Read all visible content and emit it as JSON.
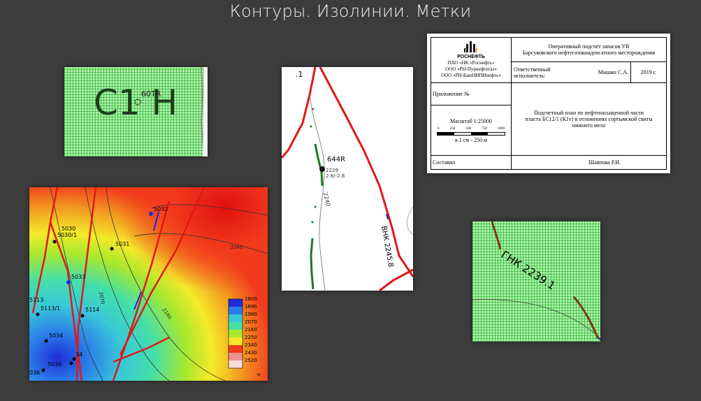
{
  "title": "Контуры. Изолинии. Метки",
  "panel1": {
    "label": "C1 H",
    "marker": "60TR"
  },
  "panel2": {
    "top_label": ".1",
    "well": "644R",
    "well_sub1": "2239",
    "well_sub2": "2.8/-2.8",
    "isoline": "2240",
    "contour": "ВНК 2245.8"
  },
  "panel3": {
    "wells": [
      "5032",
      "5030",
      "5030/1",
      "5031",
      "5033",
      "5113",
      "5113/1",
      "5114",
      "5034",
      "5036",
      "34",
      "036"
    ],
    "isolines": [
      "2340",
      "2070",
      "2160"
    ],
    "legend": [
      "1800",
      "1890",
      "1980",
      "2070",
      "2160",
      "2250",
      "2340",
      "2430",
      "2520"
    ],
    "legend_unit": "м",
    "colors": [
      "#1f2dd8",
      "#2a7ce8",
      "#39c8d8",
      "#45dfa8",
      "#a8e82c",
      "#f4ea2a",
      "#f23a1c",
      "#ef9090",
      "#f6dcdc"
    ]
  },
  "panel4": {
    "contour": "ГНК 2239.1"
  },
  "stamp": {
    "logo": "РОСНЕФТЬ",
    "org1": "ПАО «НК «Роснефть»",
    "org2": "ООО «РН-Пурнефтегаз»",
    "org3": "ООО «РН-БашНИПИнефть»",
    "title1": "Оперативный подсчет запасов УВ",
    "title2": "Барсуковского нефтегазоконденсатного месторождения",
    "resp_label": "Ответственный исполнитель:",
    "resp_name": "Мишин С.А.",
    "year": "2019 г.",
    "appendix": "Приложение №",
    "scale": "Масштаб 1:25000",
    "scale_ticks": [
      "0",
      "250",
      "500",
      "750",
      "1000"
    ],
    "scale_note": "в 1 см - 250 м",
    "desc1": "Подсчетный план по нефтенасыщенной части",
    "desc2": "пласта БС12/1 (К1v) в отложениях сортымской свиты",
    "desc3": "нижнего мела",
    "composed": "Составил",
    "composer": "Шаяпова Р.И."
  }
}
